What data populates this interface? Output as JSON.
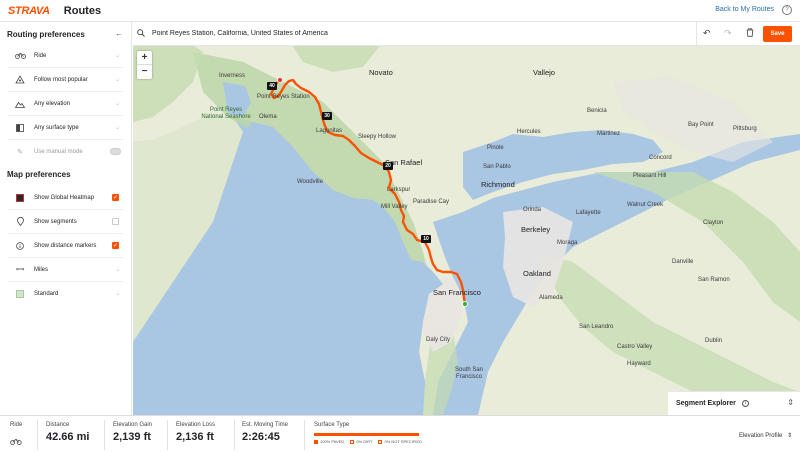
{
  "header": {
    "logo": "STRAVA",
    "title": "Routes",
    "back_link": "Back to My Routes",
    "help": "?"
  },
  "sidebar": {
    "routing_title": "Routing preferences",
    "routing_items": [
      {
        "label": "Ride",
        "icon": "bike-icon"
      },
      {
        "label": "Follow most popular",
        "icon": "popularity-icon"
      },
      {
        "label": "Any elevation",
        "icon": "elevation-icon"
      },
      {
        "label": "Any surface type",
        "icon": "surface-icon"
      }
    ],
    "manual_mode_label": "Use manual mode",
    "map_title": "Map preferences",
    "map_items": [
      {
        "label": "Show Global Heatmap",
        "checked": true
      },
      {
        "label": "Show segments",
        "checked": false
      },
      {
        "label": "Show distance markers",
        "checked": true
      },
      {
        "label": "Miles"
      },
      {
        "label": "Standard"
      }
    ]
  },
  "search": {
    "value": "Point Reyes Station, California, United States of America"
  },
  "toolbar": {
    "save_label": "Save"
  },
  "map": {
    "zoom_in": "+",
    "zoom_out": "−",
    "places": [
      {
        "name": "Novato",
        "cls": "big"
      },
      {
        "name": "Vallejo",
        "cls": "big"
      },
      {
        "name": "Inverness",
        "cls": ""
      },
      {
        "name": "Point Reyes Station",
        "cls": ""
      },
      {
        "name": "Point Reyes National Seashore",
        "cls": "green"
      },
      {
        "name": "Olema",
        "cls": ""
      },
      {
        "name": "Lagunitas",
        "cls": ""
      },
      {
        "name": "Sleepy Hollow",
        "cls": ""
      },
      {
        "name": "San Rafael",
        "cls": "big"
      },
      {
        "name": "Woodville",
        "cls": ""
      },
      {
        "name": "Larkspur",
        "cls": ""
      },
      {
        "name": "Mill Valley",
        "cls": ""
      },
      {
        "name": "Paradise Cay",
        "cls": ""
      },
      {
        "name": "San Francisco",
        "cls": "big"
      },
      {
        "name": "Daly City",
        "cls": ""
      },
      {
        "name": "South San Francisco",
        "cls": ""
      },
      {
        "name": "Benicia",
        "cls": ""
      },
      {
        "name": "Martinez",
        "cls": ""
      },
      {
        "name": "Bay Point",
        "cls": ""
      },
      {
        "name": "Pittsburg",
        "cls": ""
      },
      {
        "name": "Hercules",
        "cls": ""
      },
      {
        "name": "Pinole",
        "cls": ""
      },
      {
        "name": "Concord",
        "cls": ""
      },
      {
        "name": "Pleasant Hill",
        "cls": ""
      },
      {
        "name": "San Pablo",
        "cls": ""
      },
      {
        "name": "Richmond",
        "cls": "big"
      },
      {
        "name": "Walnut Creek",
        "cls": ""
      },
      {
        "name": "Lafayette",
        "cls": ""
      },
      {
        "name": "Berkeley",
        "cls": "big"
      },
      {
        "name": "Oakland",
        "cls": "big"
      },
      {
        "name": "Alameda",
        "cls": ""
      },
      {
        "name": "Danville",
        "cls": ""
      },
      {
        "name": "San Ramon",
        "cls": ""
      },
      {
        "name": "San Leandro",
        "cls": ""
      },
      {
        "name": "Castro Valley",
        "cls": ""
      },
      {
        "name": "Dublin",
        "cls": ""
      },
      {
        "name": "Hayward",
        "cls": ""
      },
      {
        "name": "Moraga",
        "cls": ""
      },
      {
        "name": "Orinda",
        "cls": ""
      },
      {
        "name": "Clayton",
        "cls": ""
      }
    ],
    "distance_markers": [
      "40",
      "30",
      "20",
      "10"
    ],
    "route_color": "#fc5200"
  },
  "segment_explorer": {
    "title": "Segment Explorer"
  },
  "footer": {
    "mode_label": "Ride",
    "distance_label": "Distance",
    "distance_value": "42.66 mi",
    "gain_label": "Elevation Gain",
    "gain_value": "2,139 ft",
    "loss_label": "Elevation Loss",
    "loss_value": "2,136 ft",
    "time_label": "Est. Moving Time",
    "time_value": "2:26:45",
    "surface_label": "Surface Type",
    "surface_paved": "100% PAVED",
    "surface_dirt": "0% DIRT",
    "surface_unknown": "0% NOT SPECIFIED",
    "elevation_profile": "Elevation Profile"
  }
}
